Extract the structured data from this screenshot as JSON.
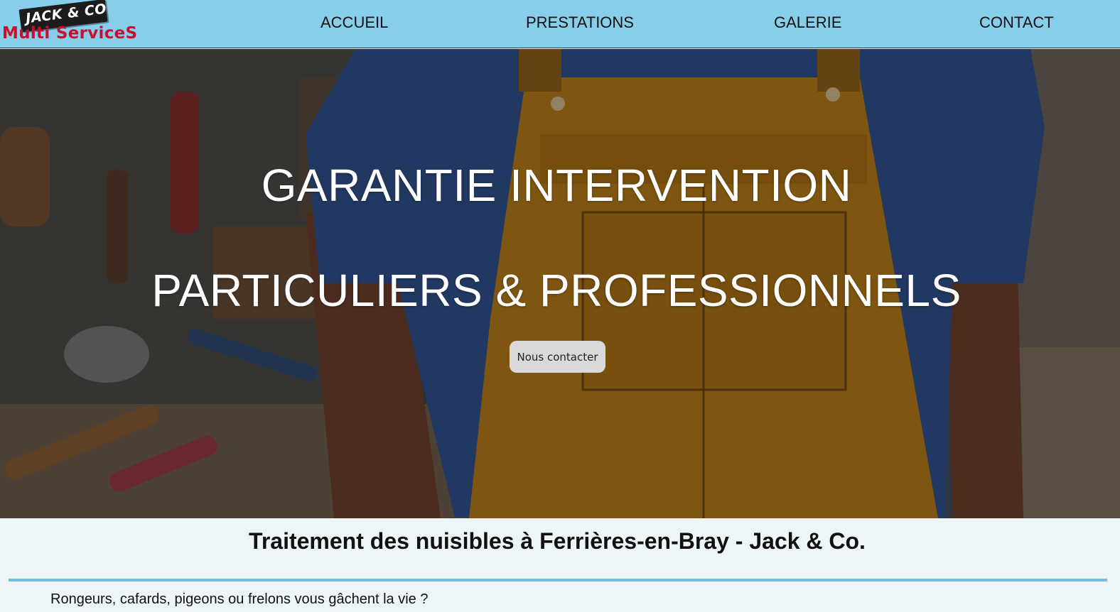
{
  "logo": {
    "top_text": "JACK & CO",
    "bottom_text": "Multi ServiceS",
    "text_color": "#c8102e"
  },
  "nav": {
    "items": [
      {
        "label": "ACCUEIL"
      },
      {
        "label": "PRESTATIONS"
      },
      {
        "label": "GALERIE"
      },
      {
        "label": "CONTACT"
      }
    ],
    "background": "#87ceeb"
  },
  "hero": {
    "line1": "GARANTIE INTERVENTION",
    "line2": "PARTICULIERS & PROFESSIONNELS",
    "button_label": "Nous contacter"
  },
  "content": {
    "title": "Traitement des nuisibles à Ferrières-en-Bray - Jack & Co.",
    "intro": "Rongeurs, cafards, pigeons ou frelons vous gâchent la vie ?",
    "divider_color": "#74bde0"
  }
}
